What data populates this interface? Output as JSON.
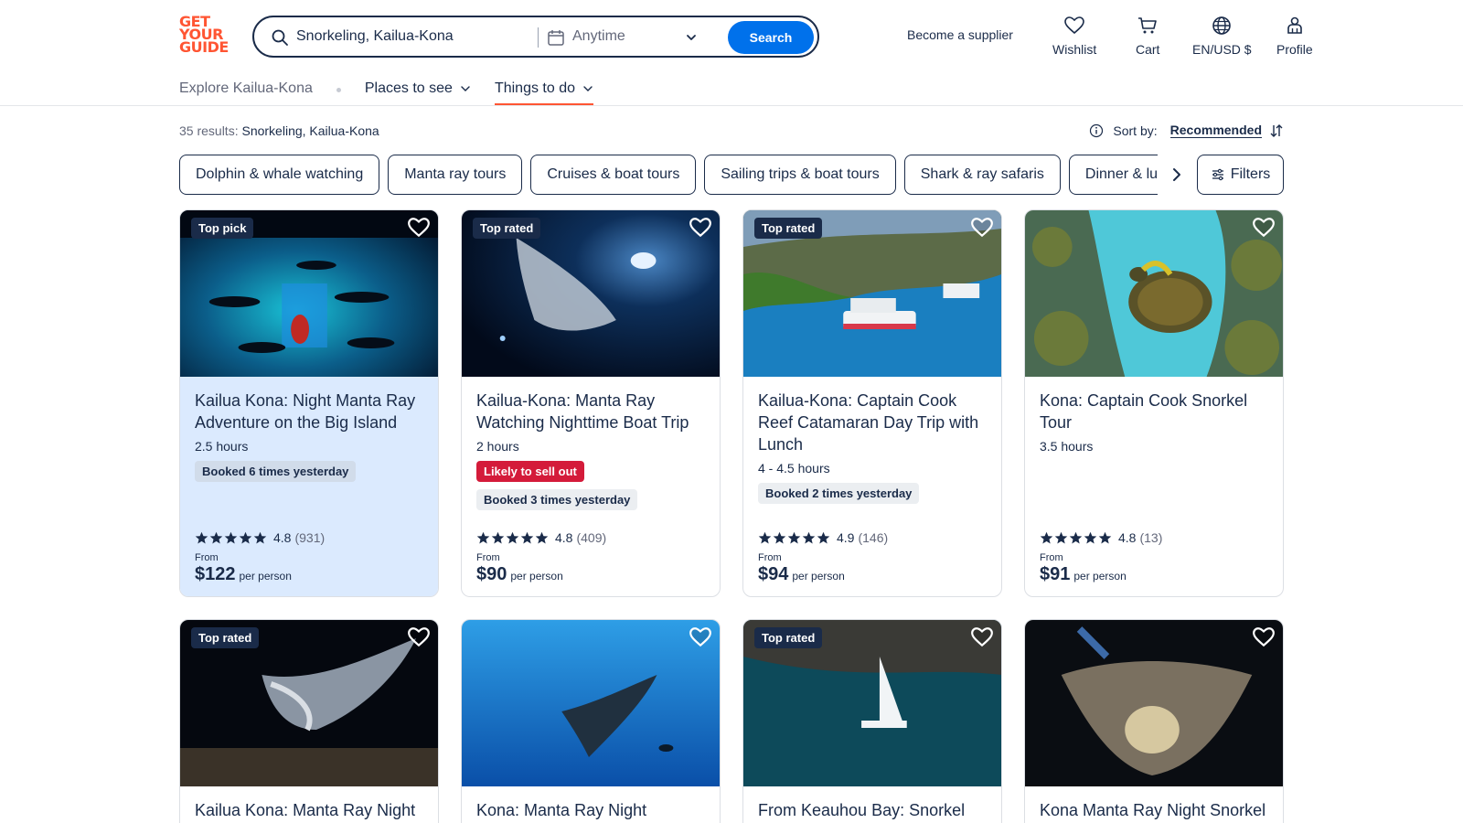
{
  "header": {
    "logo_lines": [
      "GET",
      "YOUR",
      "GUIDE"
    ],
    "search_value": "Snorkeling, Kailua-Kona",
    "date_value": "Anytime",
    "search_button": "Search",
    "become_supplier": "Become a supplier",
    "nav": {
      "wishlist": "Wishlist",
      "cart": "Cart",
      "locale": "EN/USD $",
      "profile": "Profile"
    }
  },
  "subnav": {
    "explore": "Explore Kailua-Kona",
    "places": "Places to see",
    "things": "Things to do"
  },
  "results": {
    "count_label": "35 results:",
    "query": "Snorkeling, Kailua-Kona",
    "sort_label": "Sort by:",
    "sort_value": "Recommended"
  },
  "chips": [
    "Dolphin & whale watching",
    "Manta ray tours",
    "Cruises & boat tours",
    "Sailing trips & boat tours",
    "Shark & ray safaris",
    "Dinner & lunch"
  ],
  "filters_label": "Filters",
  "cards": [
    {
      "badge": "Top pick",
      "title": "Kailua Kona: Night Manta Ray Adventure on the Big Island",
      "duration": "2.5 hours",
      "booked": "Booked 6 times yesterday",
      "rating": "4.8",
      "reviews": "(931)",
      "from": "From",
      "price": "$122",
      "per": "per person"
    },
    {
      "badge": "Top rated",
      "title": "Kailua-Kona: Manta Ray Watching Nighttime Boat Trip",
      "duration": "2 hours",
      "sellout": "Likely to sell out",
      "booked": "Booked 3 times yesterday",
      "rating": "4.8",
      "reviews": "(409)",
      "from": "From",
      "price": "$90",
      "per": "per person"
    },
    {
      "badge": "Top rated",
      "title": "Kailua-Kona: Captain Cook Reef Catamaran Day Trip with Lunch",
      "duration": "4 - 4.5 hours",
      "booked": "Booked 2 times yesterday",
      "rating": "4.9",
      "reviews": "(146)",
      "from": "From",
      "price": "$94",
      "per": "per person"
    },
    {
      "title": "Kona: Captain Cook Snorkel Tour",
      "duration": "3.5 hours",
      "rating": "4.8",
      "reviews": "(13)",
      "from": "From",
      "price": "$91",
      "per": "per person"
    },
    {
      "badge": "Top rated",
      "title": "Kailua Kona: Manta Ray Night"
    },
    {
      "title": "Kona: Manta Ray Night Snorkel"
    },
    {
      "badge": "Top rated",
      "title": "From Keauhou Bay: Snorkel"
    },
    {
      "title": "Kona Manta Ray Night Snorkel"
    }
  ]
}
